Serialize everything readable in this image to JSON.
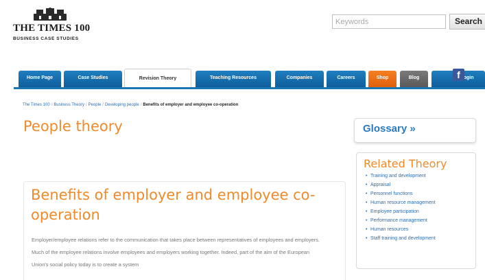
{
  "header": {
    "logo_title": "THE TIMES 100",
    "logo_subtitle": "BUSINESS CASE STUDIES",
    "search_placeholder": "Keywords",
    "search_button": "Search"
  },
  "nav": {
    "items": [
      {
        "label": "Home Page"
      },
      {
        "label": "Case Studies"
      },
      {
        "label": "Revision Theory"
      },
      {
        "label": "Teaching Resources"
      },
      {
        "label": "Companies"
      },
      {
        "label": "Careers"
      },
      {
        "label": "Shop"
      },
      {
        "label": "Blog"
      },
      {
        "label": "Login"
      }
    ],
    "facebook_glyph": "f",
    "colors": {
      "blue": "#1473b5",
      "orange": "#f26f1b",
      "grey": "#6b6b6b"
    }
  },
  "breadcrumb": {
    "items": [
      "The Times 100",
      "Business Theory",
      "People",
      "Developing people"
    ],
    "separator": "/",
    "current": "Benefits of employer and employee co-operation"
  },
  "main": {
    "page_title": "People theory",
    "article_title": "Benefits of employer and employee co-operation",
    "paragraphs": [
      "Employer/employee relations refer to the communication that takes place between representatives of employees and employers.",
      "Much of the employee relations involve employees and employers working together. Indeed, part of the aim of the European Union's social policy today is to create a system"
    ]
  },
  "sidebar": {
    "glossary_link": "Glossary »",
    "related_title": "Related Theory",
    "related_items": [
      "Training and development",
      "Appraisal",
      "Personnel functions",
      "Human resource management",
      "Employee participation",
      "Performance management",
      "Human resources",
      "Staff training and development"
    ]
  }
}
